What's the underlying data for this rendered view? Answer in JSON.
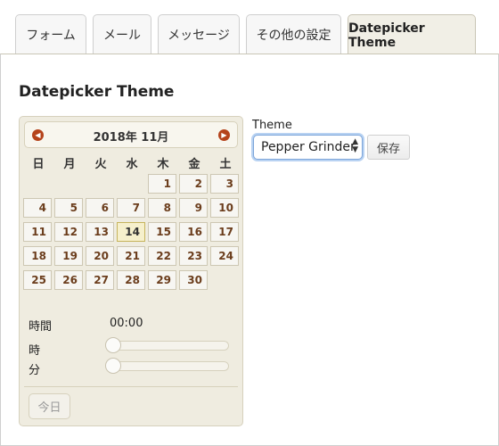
{
  "tabs": [
    {
      "label": "フォーム",
      "active": false
    },
    {
      "label": "メール",
      "active": false
    },
    {
      "label": "メッセージ",
      "active": false
    },
    {
      "label": "その他の設定",
      "active": false
    },
    {
      "label": "Datepicker Theme",
      "active": true
    }
  ],
  "panel": {
    "title": "Datepicker Theme"
  },
  "datepicker": {
    "prev_icon": "prev-arrow-icon",
    "next_icon": "next-arrow-icon",
    "title": "2018年 11月",
    "weekdays": [
      "日",
      "月",
      "火",
      "水",
      "木",
      "金",
      "土"
    ],
    "days": [
      "1",
      "2",
      "3",
      "4",
      "5",
      "6",
      "7",
      "8",
      "9",
      "10",
      "11",
      "12",
      "13",
      "14",
      "15",
      "16",
      "17",
      "18",
      "19",
      "20",
      "21",
      "22",
      "23",
      "24",
      "25",
      "26",
      "27",
      "28",
      "29",
      "30"
    ],
    "first_weekday_index": 4,
    "today": "14",
    "time_label": "時間",
    "time_value": "00:00",
    "hour_label": "時",
    "minute_label": "分",
    "hour_value": 0,
    "minute_value": 0,
    "today_button": "今日"
  },
  "theme": {
    "label": "Theme",
    "selected": "Pepper Grinder",
    "save_label": "保存"
  },
  "colors": {
    "accent": "#b5431b",
    "day_text": "#6b3d1c",
    "datepicker_bg": "#efece0"
  }
}
